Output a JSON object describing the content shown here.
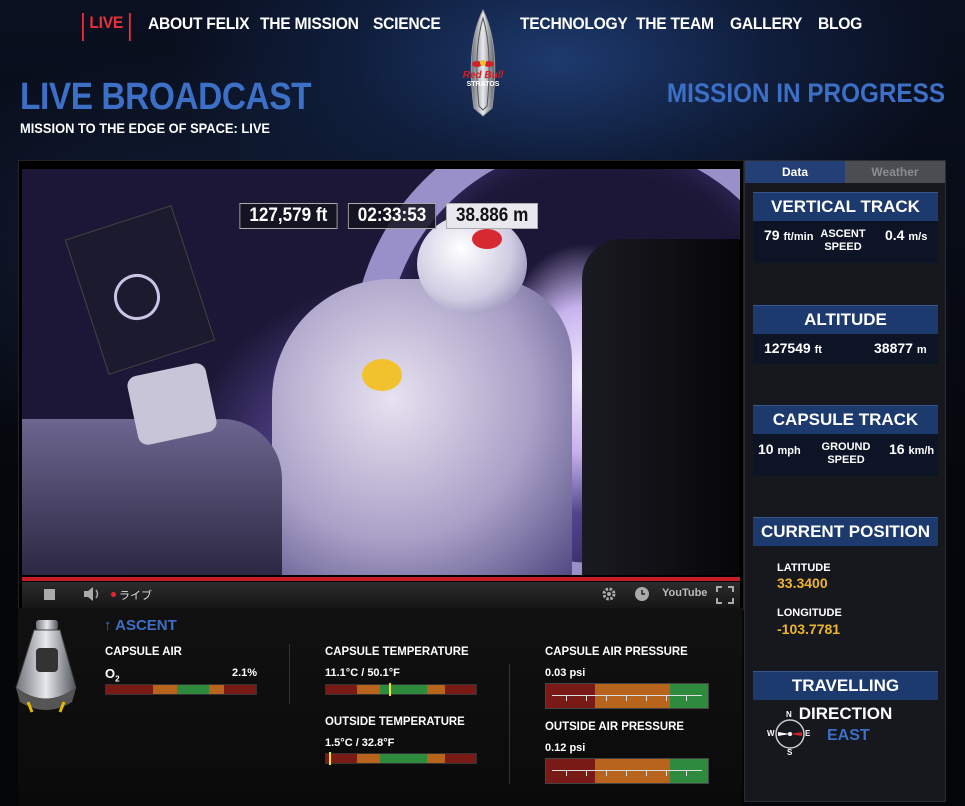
{
  "nav": {
    "live": "LIVE",
    "items": [
      "ABOUT FELIX",
      "THE MISSION",
      "SCIENCE",
      "TECHNOLOGY",
      "THE TEAM",
      "GALLERY",
      "BLOG"
    ]
  },
  "logo": {
    "brand": "Red Bull",
    "product": "STRATOS"
  },
  "header": {
    "title": "LIVE BROADCAST",
    "subtitle": "MISSION TO THE EDGE OF SPACE: LIVE",
    "status": "MISSION IN PROGRESS"
  },
  "video": {
    "overlay_feet": "127,579 ft",
    "overlay_time": "02:33:53",
    "overlay_meters": "38.886 m",
    "progress": 1.0,
    "live_label": "ライブ",
    "youtube_label": "YouTube"
  },
  "panel": {
    "tabs": [
      "Data",
      "Weather"
    ],
    "active_tab": "Data",
    "vertical_track": {
      "title": "VERTICAL TRACK",
      "left_value": "79",
      "left_unit": "ft/min",
      "middle_label": [
        "ASCENT",
        "SPEED"
      ],
      "right_value": "0.4",
      "right_unit": "m/s"
    },
    "altitude": {
      "title": "ALTITUDE",
      "left_value": "127549",
      "left_unit": "ft",
      "right_value": "38877",
      "right_unit": "m"
    },
    "capsule_track": {
      "title": "CAPSULE TRACK",
      "left_value": "10",
      "left_unit": "mph",
      "middle_label": [
        "GROUND",
        "SPEED"
      ],
      "right_value": "16",
      "right_unit": "km/h"
    },
    "current_position": {
      "title": "CURRENT POSITION",
      "latitude_label": "LATITUDE",
      "latitude": "33.3400",
      "longitude_label": "LONGITUDE",
      "longitude": "-103.7781"
    },
    "travelling_direction": {
      "title": "TRAVELLING DIRECTION",
      "compass": [
        "N",
        "E",
        "S",
        "W"
      ],
      "direction": "EAST"
    }
  },
  "stats": {
    "phase": "ASCENT",
    "capsule_air": {
      "title": "CAPSULE AIR",
      "gas": "O2",
      "value": "2.1%"
    },
    "capsule_temperature": {
      "title": "CAPSULE TEMPERATURE",
      "value": "11.1°C / 50.1°F"
    },
    "outside_temperature": {
      "title": "OUTSIDE TEMPERATURE",
      "value": "1.5°C / 32.8°F"
    },
    "capsule_air_pressure": {
      "title": "CAPSULE AIR PRESSURE",
      "value": "0.03 psi"
    },
    "outside_air_pressure": {
      "title": "OUTSIDE AIR PRESSURE",
      "value": "0.12 psi"
    }
  },
  "colors": {
    "accent_blue": "#3c6fc6",
    "live_red": "#e8303a",
    "coordinate_gold": "#f0b429"
  }
}
